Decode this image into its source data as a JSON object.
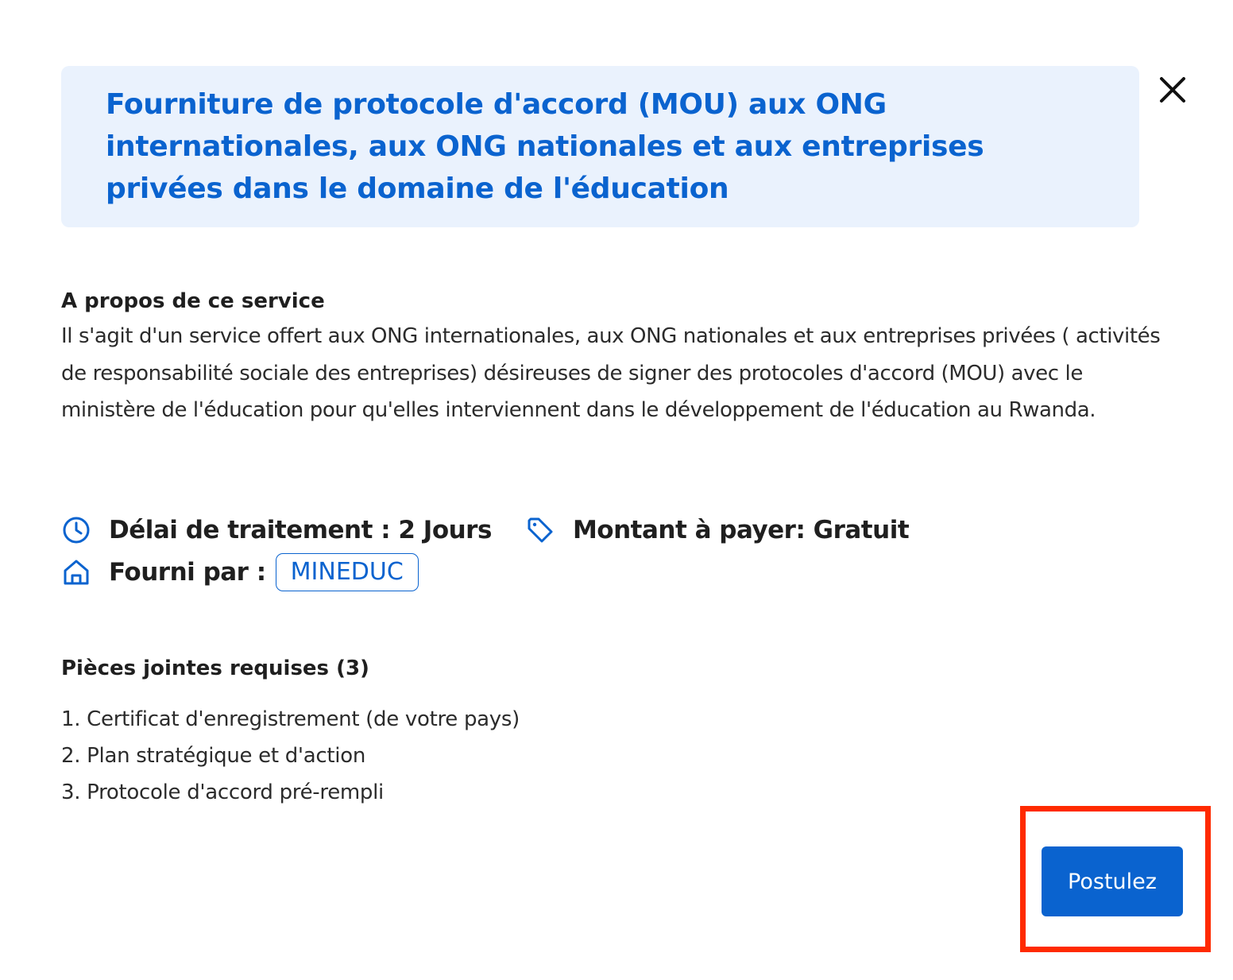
{
  "header": {
    "title": "Fourniture de protocole d'accord (MOU) aux ONG internationales, aux ONG nationales et aux entreprises privées dans le domaine de l'éducation"
  },
  "about": {
    "heading": "A propos de ce service",
    "body": "Il s'agit d'un service offert aux ONG internationales, aux ONG nationales et aux entreprises privées ( activités de responsabilité sociale des entreprises) désireuses de signer des protocoles d'accord (MOU) avec le ministère de l'éducation pour qu'elles interviennent dans le développement de l'éducation au Rwanda."
  },
  "meta": {
    "processing_time": "Délai de traitement : 2 Jours",
    "amount": "Montant à payer: Gratuit",
    "provided_by_label": "Fourni par :",
    "provider": "MINEDUC"
  },
  "attachments": {
    "heading": "Pièces jointes requises (3)",
    "items": [
      "1. Certificat d'enregistrement (de votre pays)",
      "2. Plan stratégique et d'action",
      "3. Protocole d'accord pré-rempli"
    ]
  },
  "actions": {
    "apply_label": "Postulez"
  },
  "icons": {
    "close": "close-icon",
    "clock": "clock-icon",
    "tag": "tag-icon",
    "home": "home-icon"
  },
  "colors": {
    "accent": "#0a63cf",
    "banner_bg": "#eaf2fd",
    "highlight": "#ff2a00"
  }
}
